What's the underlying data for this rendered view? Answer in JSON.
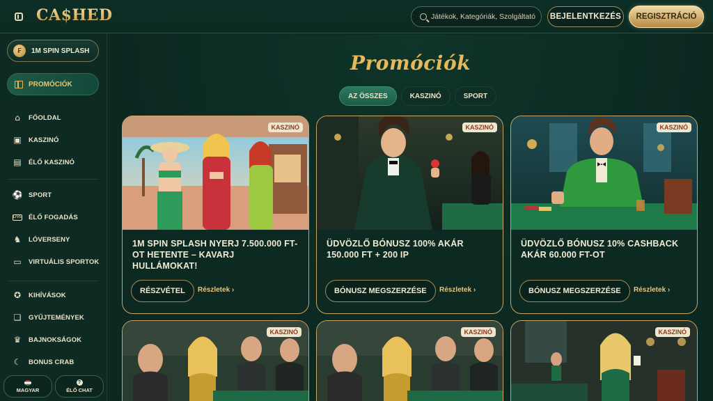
{
  "header": {
    "logo": "CA$HED",
    "search_placeholder": "Játékok, Kategóriák, Szolgáltatók",
    "login_label": "BEJELENTKEZÉS",
    "register_label": "REGISZTRÁCIÓ"
  },
  "sidebar": {
    "spin_pill": "1M SPIN SPLASH",
    "promo": "PROMÓCIÓK",
    "group1": [
      {
        "label": "FŐOLDAL",
        "icon": "home-icon"
      },
      {
        "label": "KASZINÓ",
        "icon": "slot-icon"
      },
      {
        "label": "ÉLŐ KASZINÓ",
        "icon": "live-cards-icon"
      }
    ],
    "group2": [
      {
        "label": "SPORT",
        "icon": "sport-icon"
      },
      {
        "label": "ÉLŐ FOGADÁS",
        "icon": "live-icon"
      },
      {
        "label": "LÓVERSENY",
        "icon": "horse-icon"
      },
      {
        "label": "VIRTUÁLIS SPORTOK",
        "icon": "virtual-icon"
      }
    ],
    "group3": [
      {
        "label": "KIHÍVÁSOK",
        "icon": "medal-icon"
      },
      {
        "label": "GYŰJTEMÉNYEK",
        "icon": "cards-icon"
      },
      {
        "label": "BAJNOKSÁGOK",
        "icon": "trophy-icon"
      },
      {
        "label": "BONUS CRAB",
        "icon": "claw-icon"
      }
    ],
    "language_label": "MAGYAR",
    "chat_label": "ÉLŐ CHAT"
  },
  "main": {
    "title": "Promóciók",
    "filters": [
      "AZ ÖSSZES",
      "KASZINÓ",
      "SPORT"
    ],
    "cards": [
      {
        "badge": "KASZINÓ",
        "title": "1M SPIN SPLASH NYERJ 7.500.000 FT-OT HETENTE – KAVARJ HULLÁMOKAT!",
        "cta": "RÉSZVÉTEL",
        "link": "Részletek ›"
      },
      {
        "badge": "KASZINÓ",
        "title": "ÜDVÖZLŐ BÓNUSZ 100% AKÁR 150.000 FT + 200 IP",
        "cta": "BÓNUSZ MEGSZERZÉSE",
        "link": "Részletek ›"
      },
      {
        "badge": "KASZINÓ",
        "title": "ÜDVÖZLŐ BÓNUSZ 10% CASHBACK AKÁR 60.000 FT-OT",
        "cta": "BÓNUSZ MEGSZERZÉSE",
        "link": "Részletek ›"
      }
    ],
    "bottom_cards": [
      {
        "badge": "KASZINÓ"
      },
      {
        "badge": "KASZINÓ"
      },
      {
        "badge": "KASZINÓ"
      }
    ]
  },
  "colors": {
    "background": "#0c2a22",
    "accent_gold": "#e5b85c",
    "card_border": "#c9a869",
    "badge_text": "#8b3b1e"
  }
}
